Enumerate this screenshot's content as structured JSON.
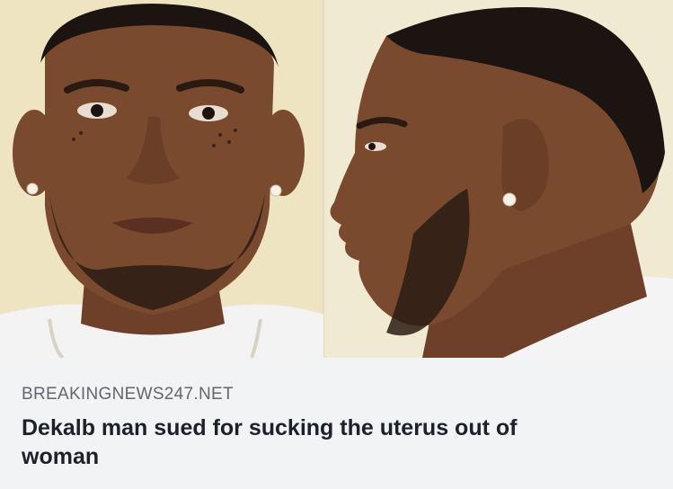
{
  "link_preview": {
    "image": {
      "icon": "mugshot-photo",
      "colors": {
        "background": "#efe6c8",
        "skin": "#7a4a2f",
        "hair": "#1b1410",
        "shirt": "#f4f4f4"
      }
    },
    "source": "BREAKINGNEWS247.NET",
    "headline": "Dekalb man sued for sucking the uterus out of woman",
    "colors": {
      "caption_background": "#f2f3f5",
      "source_text": "#606770",
      "headline_text": "#1d2129"
    }
  }
}
